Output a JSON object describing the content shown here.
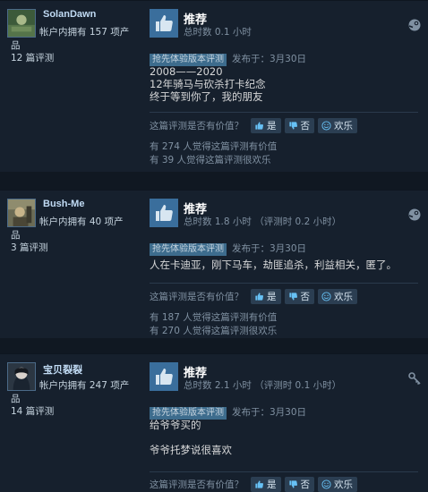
{
  "reviews": [
    {
      "username": "SolanDawn",
      "owned_line1": "帐户内拥有 157 项产",
      "owned_line2": "品",
      "review_count": "12 篇评测",
      "recommendation": "推荐",
      "hours": "总时数 0.1 小时",
      "early_access_badge": "抢先体验版本评测",
      "posted": "发布于：3月30日",
      "body": "2008——2020\n12年骑马与砍杀打卡纪念\n终于等到你了，我的朋友",
      "helpful_question": "这篇评测是否有价值？",
      "yes_label": "是",
      "no_label": "否",
      "funny_label": "欢乐",
      "helpful_stat": "有 274 人觉得这篇评测有价值",
      "funny_stat": "有 39 人觉得这篇评测很欢乐",
      "platform_icon": "steam-icon"
    },
    {
      "username": "Bush-Me",
      "owned_line1": "帐户内拥有 40 项产",
      "owned_line2": "品",
      "review_count": "3 篇评测",
      "recommendation": "推荐",
      "hours": "总时数 1.8 小时 （评测时 0.2 小时）",
      "early_access_badge": "抢先体验版本评测",
      "posted": "发布于：3月30日",
      "body": "人在卡迪亚，刚下马车，劫匪追杀，利益相关，匿了。",
      "helpful_question": "这篇评测是否有价值？",
      "yes_label": "是",
      "no_label": "否",
      "funny_label": "欢乐",
      "helpful_stat": "有 187 人觉得这篇评测有价值",
      "funny_stat": "有 270 人觉得这篇评测很欢乐",
      "platform_icon": "steam-icon"
    },
    {
      "username": "宝贝裂裂",
      "owned_line1": "帐户内拥有 247 项产",
      "owned_line2": "品",
      "review_count": "14 篇评测",
      "recommendation": "推荐",
      "hours": "总时数 2.1 小时 （评测时 0.1 小时）",
      "early_access_badge": "抢先体验版本评测",
      "posted": "发布于：3月30日",
      "body": "给爷爷买的\n\n爷爷托梦说很喜欢",
      "helpful_question": "这篇评测是否有价值？",
      "yes_label": "是",
      "no_label": "否",
      "funny_label": "欢乐",
      "platform_icon": "key-icon"
    }
  ],
  "colors": {
    "background": "#1b2838",
    "card": "#16202d",
    "thumb_box": "#3a6e9c",
    "badge": "#3d6c8d",
    "username": "#c1dbf4",
    "muted": "#8091a2"
  }
}
